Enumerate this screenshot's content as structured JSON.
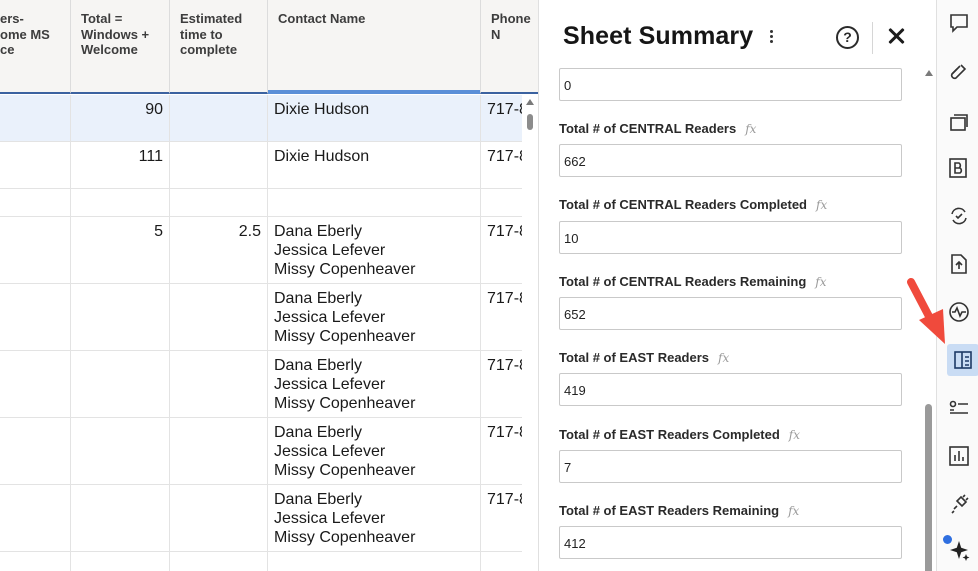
{
  "grid": {
    "headers": [
      {
        "label": "ers-\nome MS\nce"
      },
      {
        "label": "Total =\nWindows +\nWelcome"
      },
      {
        "label": "Estimated\ntime to\ncomplete"
      },
      {
        "label": "Contact Name"
      },
      {
        "label": "Phone N"
      }
    ],
    "rows": [
      {
        "total": "90",
        "estimated": "",
        "contact": "Dixie Hudson",
        "phone": "717-8"
      },
      {
        "total": "111",
        "estimated": "",
        "contact": "Dixie Hudson",
        "phone": "717-8"
      },
      {
        "total": "",
        "estimated": "",
        "contact": "",
        "phone": ""
      },
      {
        "total": "5",
        "estimated": "2.5",
        "contact": "Dana Eberly\nJessica Lefever\nMissy Copenheaver",
        "phone": "717-8"
      },
      {
        "total": "",
        "estimated": "",
        "contact": "Dana Eberly\nJessica Lefever\nMissy Copenheaver",
        "phone": "717-8"
      },
      {
        "total": "",
        "estimated": "",
        "contact": "Dana Eberly\nJessica Lefever\nMissy Copenheaver",
        "phone": "717-8"
      },
      {
        "total": "",
        "estimated": "",
        "contact": "Dana Eberly\nJessica Lefever\nMissy Copenheaver",
        "phone": "717-8"
      },
      {
        "total": "",
        "estimated": "",
        "contact": "Dana Eberly\nJessica Lefever\nMissy Copenheaver",
        "phone": "717-8"
      }
    ]
  },
  "panel": {
    "title": "Sheet Summary",
    "help_symbol": "?",
    "fx_symbol": "fx",
    "fields": [
      {
        "label": "",
        "value": "0"
      },
      {
        "label": "Total # of CENTRAL Readers",
        "value": "662"
      },
      {
        "label": "Total # of CENTRAL Readers Completed",
        "value": "10"
      },
      {
        "label": "Total # of CENTRAL Readers Remaining",
        "value": "652"
      },
      {
        "label": "Total # of EAST Readers",
        "value": "419"
      },
      {
        "label": "Total # of EAST Readers Completed",
        "value": "7"
      },
      {
        "label": "Total # of EAST Readers Remaining",
        "value": "412"
      }
    ]
  },
  "rail": {
    "icons": [
      "comment-icon",
      "attachment-icon",
      "proofing-icon",
      "brandfolder-icon",
      "update-requests-icon",
      "publish-icon",
      "activity-log-icon",
      "sheet-summary-icon",
      "forms-icon",
      "reports-icon",
      "connectors-icon",
      "ai-sparkle-icon"
    ],
    "active": "sheet-summary-icon",
    "accent_color": "#2f6fe0",
    "arrow_color": "#f04a3c"
  }
}
